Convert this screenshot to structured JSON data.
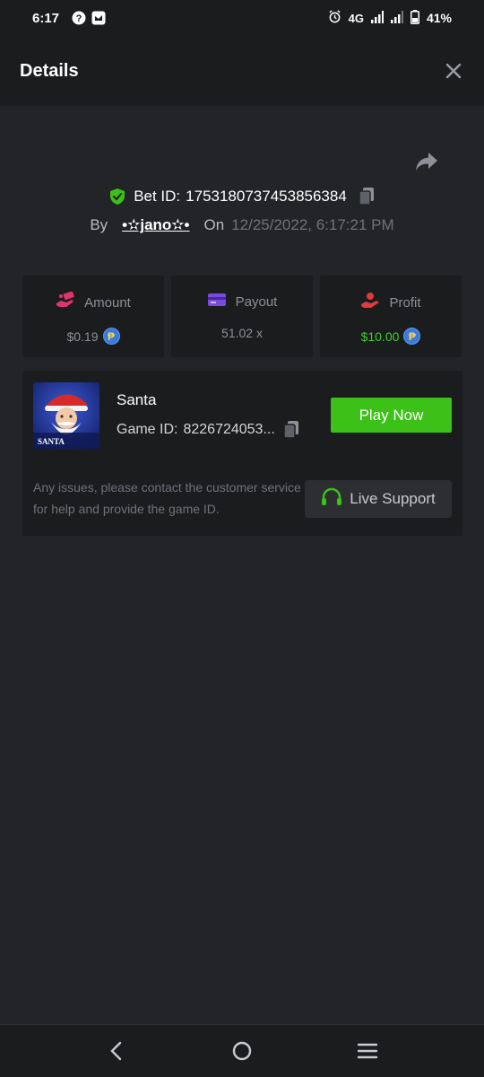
{
  "status_bar": {
    "time": "6:17",
    "network": "4G",
    "battery": "41%",
    "icons": [
      "help-icon",
      "app-icon",
      "alarm-icon",
      "signal-icon",
      "signal-icon",
      "battery-icon"
    ]
  },
  "header": {
    "title": "Details",
    "close_icon": "close-icon"
  },
  "bet": {
    "label": "Bet ID:",
    "id": "1753180737453856384",
    "by_label": "By",
    "user": "•✫jano✫•",
    "on_label": "On",
    "date": "12/25/2022, 6:17:21 PM"
  },
  "stats": {
    "amount": {
      "label": "Amount",
      "value": "$0.19",
      "icon": "money-hand-icon",
      "color": "#e0356b"
    },
    "payout": {
      "label": "Payout",
      "value": "51.02 x",
      "icon": "card-icon",
      "color": "#7b4ae0"
    },
    "profit": {
      "label": "Profit",
      "value": "$10.00",
      "icon": "profit-hand-icon",
      "color": "#e03a3a"
    }
  },
  "game": {
    "name": "Santa",
    "id_label": "Game ID:",
    "id": "8226724053...",
    "thumb_label": "SANTA",
    "play_label": "Play Now",
    "issues_text": "Any issues, please contact the customer service for help and provide the game ID.",
    "support_label": "Live Support"
  },
  "colors": {
    "accent_green": "#3bc117",
    "profit_green": "#3ecf2a",
    "background": "#232427",
    "card": "#1b1c1e"
  },
  "nav": [
    "back-icon",
    "home-icon",
    "menu-icon"
  ]
}
